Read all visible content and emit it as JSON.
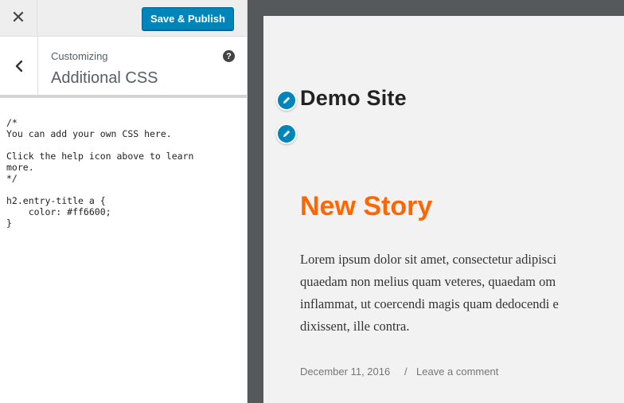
{
  "customizer": {
    "close_icon": "close-icon",
    "publish_label": "Save & Publish",
    "back_icon": "chevron-left-icon",
    "breadcrumb_label": "Customizing",
    "section_title": "Additional CSS",
    "help_icon_glyph": "?",
    "code_lines": [
      "/*",
      "You can add your own CSS here.",
      "",
      "Click the help icon above to learn",
      "more.",
      "*/",
      "",
      "h2.entry-title a {",
      "    color: #ff6600;",
      "}"
    ]
  },
  "preview": {
    "site_title": "Demo Site",
    "post_title": "New Story",
    "excerpt_lines": [
      "Lorem ipsum dolor sit amet, consectetur adipisci",
      "quaedam non melius quam veteres, quaedam om",
      "inflammat, ut coercendi magis quam dedocendi e",
      "dixissent, ille contra."
    ],
    "post_date": "December 11, 2016",
    "meta_separator": "/",
    "comment_link": "Leave a comment",
    "edit_icon": "pencil-icon"
  },
  "colors": {
    "publish_button": "#0085ba",
    "post_title": "#ff6600",
    "frame_background": "#55595c"
  }
}
